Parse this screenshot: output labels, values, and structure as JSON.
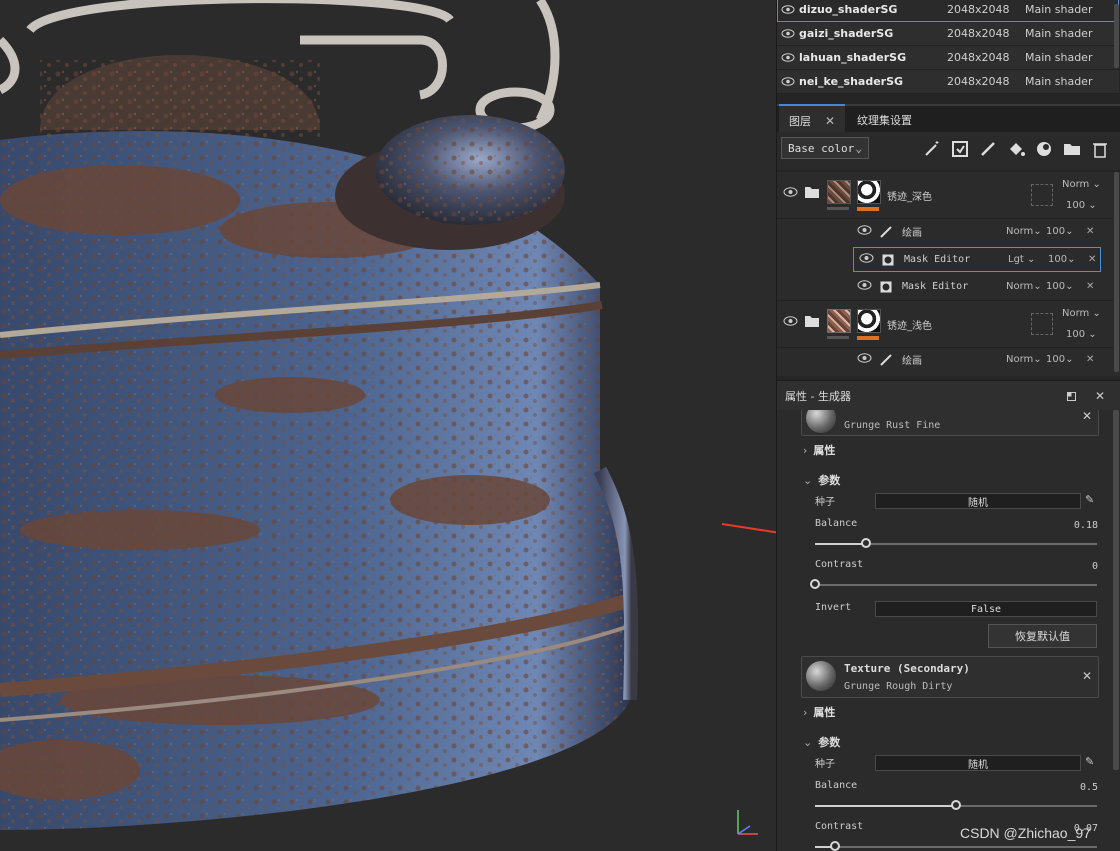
{
  "texture_sets": [
    {
      "name": "dizuo_shaderSG",
      "resolution": "2048x2048",
      "shader": "Main shader",
      "selected": true
    },
    {
      "name": "gaizi_shaderSG",
      "resolution": "2048x2048",
      "shader": "Main shader"
    },
    {
      "name": "lahuan_shaderSG",
      "resolution": "2048x2048",
      "shader": "Main shader"
    },
    {
      "name": "nei_ke_shaderSG",
      "resolution": "2048x2048",
      "shader": "Main shader"
    }
  ],
  "tabs": [
    {
      "label": "图层",
      "close": "✕",
      "active": true
    },
    {
      "label": "纹理集设置"
    }
  ],
  "toolbar": {
    "channel": "Base color"
  },
  "layers": {
    "group1": {
      "name": "锈迹_深色",
      "blend": "Norm",
      "opacity": "100"
    },
    "group1_subs": [
      {
        "name": "绘画",
        "blend": "Norm",
        "opacity": "100"
      },
      {
        "name": "Mask Editor",
        "blend": "Lgt",
        "opacity": "100",
        "selected": true
      },
      {
        "name": "Mask Editor",
        "blend": "Norm",
        "opacity": "100"
      }
    ],
    "group2": {
      "name": "锈迹_浅色",
      "blend": "Norm",
      "opacity": "100"
    },
    "group2_subs": [
      {
        "name": "绘画",
        "blend": "Norm",
        "opacity": "100"
      }
    ]
  },
  "properties": {
    "title": "属性 - 生成器",
    "texture1": {
      "subtitle": "Grunge Rust Fine"
    },
    "attr_label": "属性",
    "params_label": "参数",
    "seed_label": "种子",
    "seed_value": "随机",
    "balance_label": "Balance",
    "balance_value": "0.18",
    "balance": 0.18,
    "contrast_label": "Contrast",
    "contrast_value": "0",
    "contrast": 0,
    "invert_label": "Invert",
    "invert_value": "False",
    "reset_button": "恢复默认值",
    "texture2": {
      "title": "Texture (Secondary)",
      "subtitle": "Grunge Rough Dirty"
    },
    "attr2_label": "属性",
    "params2_label": "参数",
    "seed2_label": "种子",
    "seed2_value": "随机",
    "balance2_label": "Balance",
    "balance2_value": "0.5",
    "balance2": 0.5,
    "contrast2_label": "Contrast",
    "contrast2_value": "0.07",
    "contrast2": 0.07
  },
  "watermark": "CSDN @Zhichao_97",
  "colors": {
    "accent": "#3d8be0",
    "orange": "#e07020",
    "arrow": "#e53a2a"
  }
}
